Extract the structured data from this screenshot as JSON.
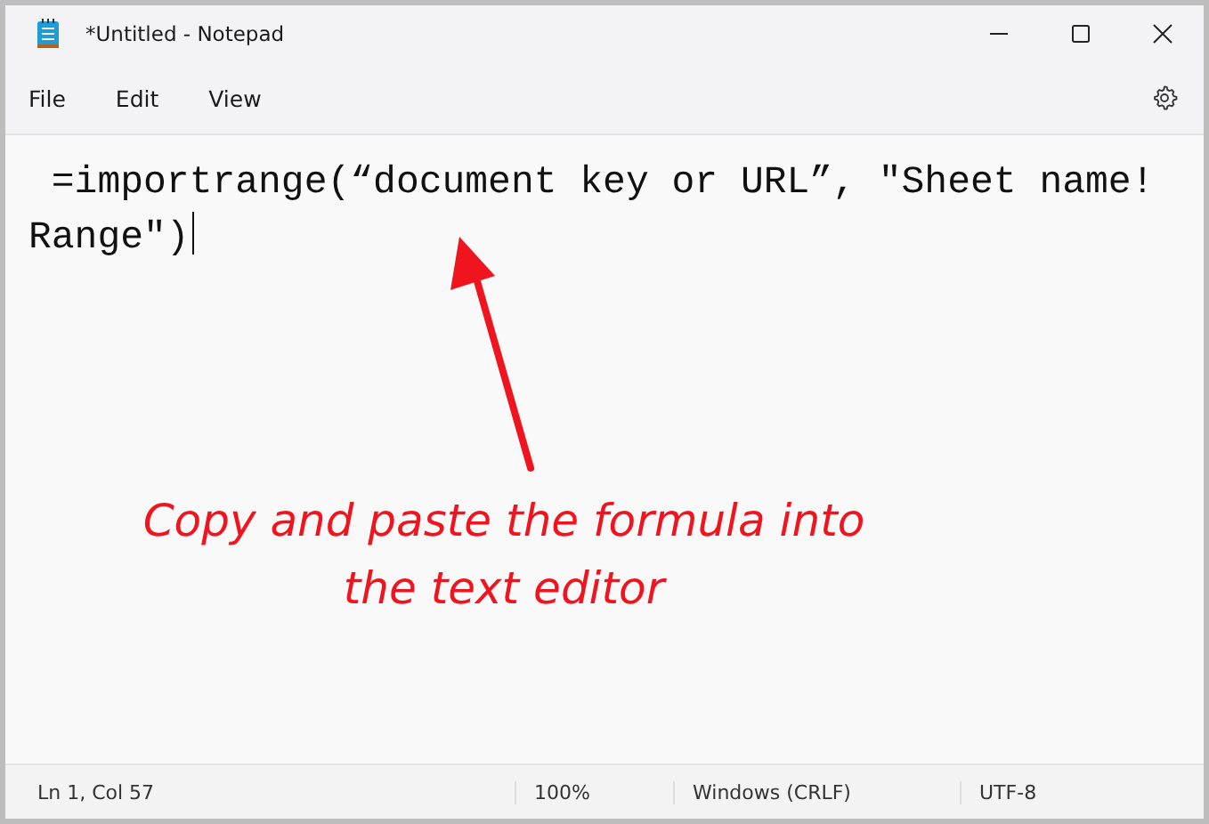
{
  "window": {
    "title": "*Untitled - Notepad"
  },
  "menu": [
    "File",
    "Edit",
    "View"
  ],
  "editor": {
    "text": " =importrange(“document key or URL”, \"Sheet name!Range\")"
  },
  "annotation": {
    "text": "Copy and paste the formula into the text editor"
  },
  "status_bar": [
    "Ln 1, Col 57",
    "100%",
    "Windows (CRLF)",
    "UTF-8"
  ]
}
